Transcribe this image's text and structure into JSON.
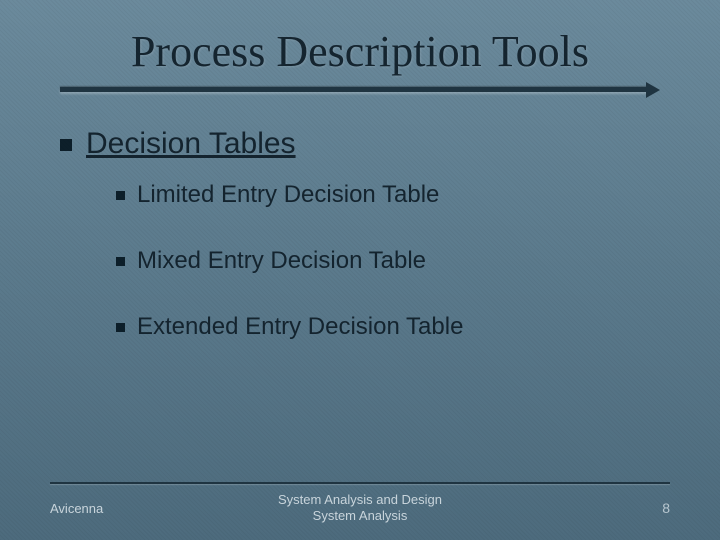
{
  "title": "Process Description Tools",
  "heading": {
    "text": "Decision Tables"
  },
  "items": [
    {
      "text": "Limited Entry Decision Table"
    },
    {
      "text": "Mixed Entry Decision Table"
    },
    {
      "text": "Extended Entry Decision Table"
    }
  ],
  "footer": {
    "left": "Avicenna",
    "center_line1": "System Analysis and Design",
    "center_line2": "System Analysis",
    "page": "8"
  }
}
